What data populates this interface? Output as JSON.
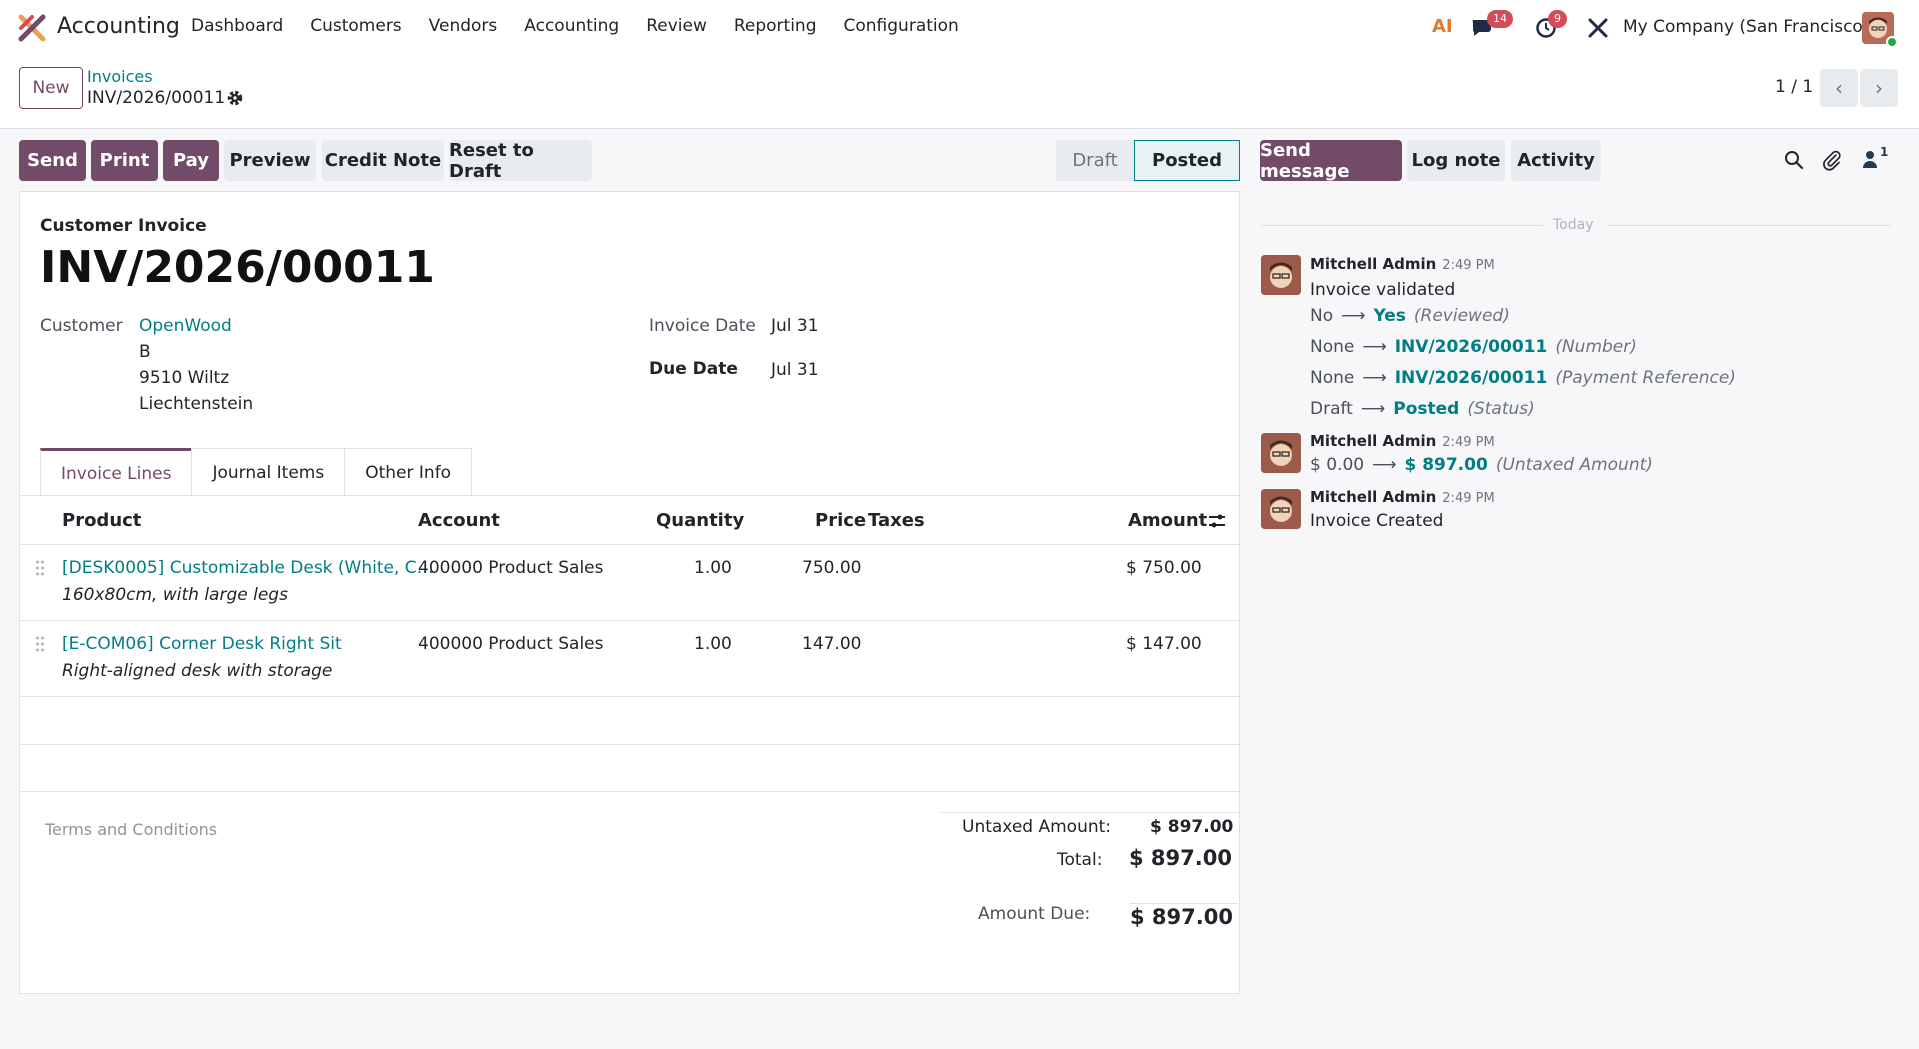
{
  "app": {
    "name": "Accounting"
  },
  "menu": [
    "Dashboard",
    "Customers",
    "Vendors",
    "Accounting",
    "Review",
    "Reporting",
    "Configuration"
  ],
  "systray": {
    "ai_label": "AI",
    "messages_count": "14",
    "activities_count": "9",
    "company": "My Company (San Francisco)"
  },
  "control": {
    "new_label": "New",
    "breadcrumb_parent": "Invoices",
    "breadcrumb_current": "INV/2026/00011",
    "pager": "1 / 1"
  },
  "actions": {
    "send": "Send",
    "print": "Print",
    "pay": "Pay",
    "preview": "Preview",
    "credit_note": "Credit Note",
    "reset": "Reset to Draft"
  },
  "status": {
    "draft": "Draft",
    "posted": "Posted"
  },
  "invoice": {
    "type": "Customer Invoice",
    "number": "INV/2026/00011",
    "customer_label": "Customer",
    "customer_name": "OpenWood",
    "address": [
      "B",
      "9510 Wiltz",
      "Liechtenstein"
    ],
    "invoice_date_label": "Invoice Date",
    "invoice_date": "Jul 31",
    "due_date_label": "Due Date",
    "due_date": "Jul 31"
  },
  "tabs": [
    "Invoice Lines",
    "Journal Items",
    "Other Info"
  ],
  "table": {
    "headers": {
      "product": "Product",
      "account": "Account",
      "quantity": "Quantity",
      "price": "Price",
      "taxes": "Taxes",
      "amount": "Amount"
    },
    "rows": [
      {
        "product": "[DESK0005] Customizable Desk (White, C…",
        "description": "160x80cm, with large legs",
        "account": "400000 Product Sales",
        "quantity": "1.00",
        "price": "750.00",
        "amount": "$ 750.00"
      },
      {
        "product": "[E-COM06] Corner Desk Right Sit",
        "description": "Right-aligned desk with storage",
        "account": "400000 Product Sales",
        "quantity": "1.00",
        "price": "147.00",
        "amount": "$ 147.00"
      }
    ]
  },
  "footer": {
    "terms_placeholder": "Terms and Conditions",
    "untaxed_label": "Untaxed Amount:",
    "untaxed_value": "$ 897.00",
    "total_label": "Total:",
    "total_value": "$ 897.00",
    "due_label": "Amount Due:",
    "due_value": "$ 897.00"
  },
  "chatter": {
    "send_message": "Send message",
    "log_note": "Log note",
    "activity": "Activity",
    "followers_count": "1",
    "today": "Today",
    "messages": [
      {
        "author": "Mitchell Admin",
        "time": "2:49 PM",
        "text": "Invoice validated",
        "tracking": [
          {
            "old": "No",
            "new": "Yes",
            "field": "(Reviewed)"
          },
          {
            "old": "None",
            "new": "INV/2026/00011",
            "field": "(Number)"
          },
          {
            "old": "None",
            "new": "INV/2026/00011",
            "field": "(Payment Reference)"
          },
          {
            "old": "Draft",
            "new": "Posted",
            "field": "(Status)"
          }
        ]
      },
      {
        "author": "Mitchell Admin",
        "time": "2:49 PM",
        "tracking": [
          {
            "old": "$ 0.00",
            "new": "$ 897.00",
            "field": "(Untaxed Amount)"
          }
        ]
      },
      {
        "author": "Mitchell Admin",
        "time": "2:49 PM",
        "text": "Invoice Created"
      }
    ]
  }
}
